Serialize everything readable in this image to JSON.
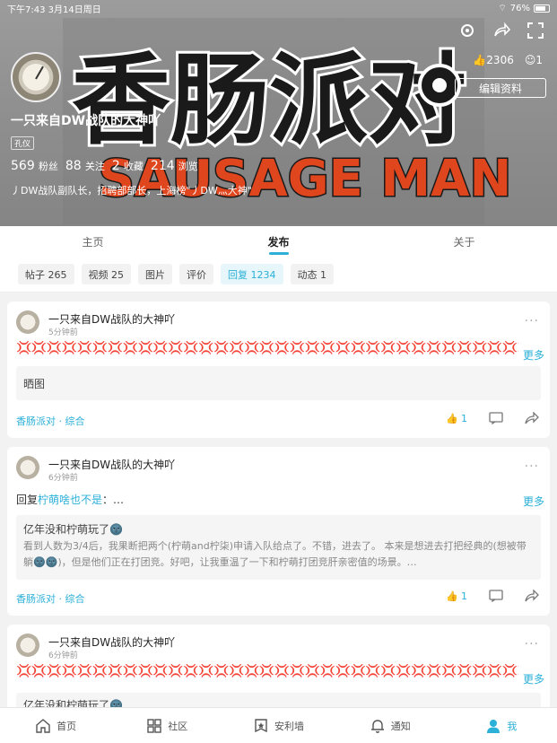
{
  "status": {
    "time": "下午7:43",
    "date": "3月14日周日",
    "battery": "76%"
  },
  "header": {
    "banner_title": "香肠派对",
    "banner_subtitle": "SAUSAGE MAN",
    "likes": "2306",
    "friends": "1",
    "edit_button": "编辑资料",
    "username": "一只来自DW战队的大神吖",
    "tag": "孔仪",
    "stats": [
      {
        "num": "569",
        "label": "粉丝"
      },
      {
        "num": "88",
        "label": "关注"
      },
      {
        "num": "2",
        "label": "收藏"
      },
      {
        "num": "214",
        "label": "浏览"
      }
    ],
    "bio": "丿DW战队副队长，招聘部部长，上海榜\"丿DW灬大神\""
  },
  "tabs": [
    {
      "label": "主页"
    },
    {
      "label": "发布"
    },
    {
      "label": "关于"
    }
  ],
  "filters": [
    {
      "label": "帖子 265"
    },
    {
      "label": "视频 25"
    },
    {
      "label": "图片"
    },
    {
      "label": "评价"
    },
    {
      "label": "回复 1234"
    },
    {
      "label": "动态 1"
    }
  ],
  "posts": [
    {
      "author": "一只来自DW战队的大神吖",
      "time": "5分钟前",
      "angry": "💢💢💢💢💢💢💢💢💢💢💢💢💢💢💢💢💢💢💢💢💢💢💢💢💢💢💢💢💢💢💢💢💢💢💢",
      "more": "更多",
      "quote_title": "晒图",
      "forum": "香肠派对 · 综合",
      "likes": "1"
    },
    {
      "author": "一只来自DW战队的大神吖",
      "time": "6分钟前",
      "reply_prefix": "回复",
      "reply_target": "柠萌啥也不是",
      "reply_suffix": "：…",
      "more": "更多",
      "quote_title": "亿年没和柠萌玩了🌚",
      "quote_body": "看到人数为3/4后，我果断把两个(柠萌and柠柒)申请入队给点了。不错，进去了。 本来是想进去打把经典的(想被带躺🌚🌚)，但是他们正在打团竞。好吧，让我重温了一下和柠萌打团竞肝亲密值的场景。…",
      "forum": "香肠派对 · 综合",
      "likes": "1"
    },
    {
      "author": "一只来自DW战队的大神吖",
      "time": "6分钟前",
      "angry": "💢💢💢💢💢💢💢💢💢💢💢💢💢💢💢💢💢💢💢💢💢💢💢💢💢💢💢💢💢💢💢💢💢💢💢",
      "more": "更多",
      "quote_title": "亿年没和柠萌玩了🌚"
    }
  ],
  "bottom_nav": [
    {
      "label": "首页",
      "icon": "home-icon"
    },
    {
      "label": "社区",
      "icon": "grid-icon"
    },
    {
      "label": "安利墙",
      "icon": "star-badge-icon"
    },
    {
      "label": "通知",
      "icon": "bell-icon"
    },
    {
      "label": "我",
      "icon": "person-icon"
    }
  ]
}
